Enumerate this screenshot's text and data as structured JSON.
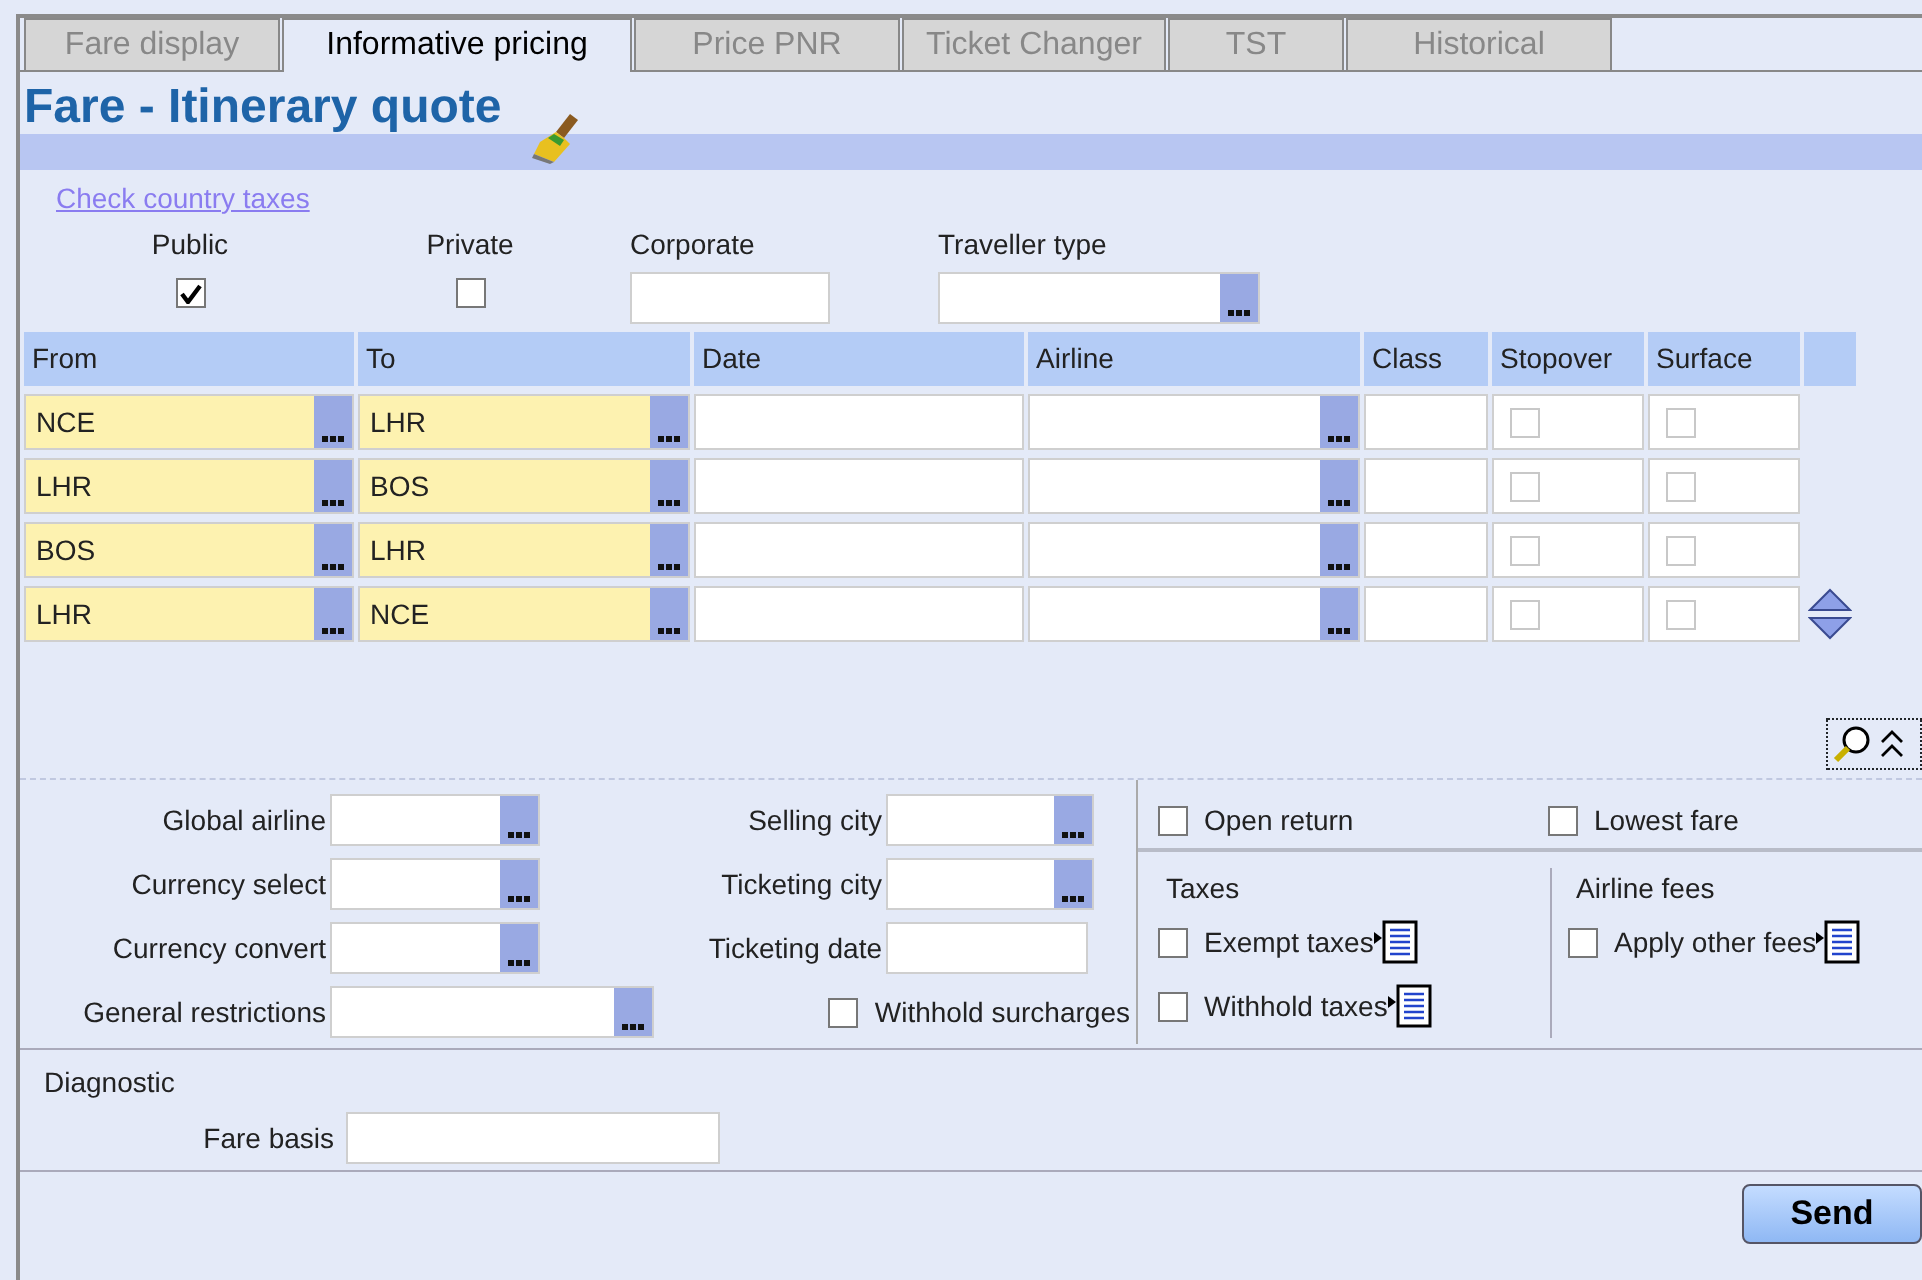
{
  "tabs": [
    {
      "label": "Fare display",
      "selected": false
    },
    {
      "label": "Informative pricing",
      "selected": true
    },
    {
      "label": "Price PNR",
      "selected": false
    },
    {
      "label": "Ticket Changer",
      "selected": false
    },
    {
      "label": "TST",
      "selected": false
    },
    {
      "label": "Historical",
      "selected": false
    }
  ],
  "title": "Fare - Itinerary quote",
  "check_country_taxes_link": "Check country taxes",
  "fare_types": [
    {
      "label": "Public",
      "kind": "checkbox",
      "checked": true
    },
    {
      "label": "Private",
      "kind": "checkbox",
      "checked": false
    },
    {
      "label": "Corporate",
      "kind": "field"
    },
    {
      "label": "Traveller type",
      "kind": "lookup"
    }
  ],
  "itinerary": {
    "columns": [
      "From",
      "To",
      "Date",
      "Airline",
      "Class",
      "Stopover",
      "Surface"
    ],
    "rows": [
      {
        "from": "NCE",
        "to": "LHR",
        "stopover_checked": false,
        "surface_checked": false
      },
      {
        "from": "LHR",
        "to": "BOS",
        "stopover_checked": false,
        "surface_checked": false
      },
      {
        "from": "BOS",
        "to": "LHR",
        "stopover_checked": false,
        "surface_checked": false
      },
      {
        "from": "LHR",
        "to": "NCE",
        "stopover_checked": false,
        "surface_checked": false
      }
    ]
  },
  "options_left": [
    {
      "label": "Global airline",
      "kind": "lookup"
    },
    {
      "label": "Currency select",
      "kind": "lookup"
    },
    {
      "label": "Currency convert",
      "kind": "lookup"
    },
    {
      "label": "General restrictions",
      "kind": "lookup_wide"
    }
  ],
  "options_middle": [
    {
      "label": "Selling city",
      "kind": "lookup"
    },
    {
      "label": "Ticketing city",
      "kind": "lookup"
    },
    {
      "label": "Ticketing date",
      "kind": "field"
    },
    {
      "label": "Withhold surcharges",
      "kind": "checkbox",
      "checked": false
    }
  ],
  "flags": [
    {
      "label": "Open return",
      "checked": false
    },
    {
      "label": "Lowest fare",
      "checked": false
    }
  ],
  "taxes": {
    "title": "Taxes",
    "options": [
      {
        "label": "Exempt taxes",
        "checked": false
      },
      {
        "label": "Withhold taxes",
        "checked": false
      }
    ]
  },
  "airline_fees": {
    "title": "Airline fees",
    "options": [
      {
        "label": "Apply other fees",
        "checked": false
      }
    ]
  },
  "diagnostic": {
    "title": "Diagnostic",
    "fare_basis_label": "Fare basis"
  },
  "send_button": "Send"
}
